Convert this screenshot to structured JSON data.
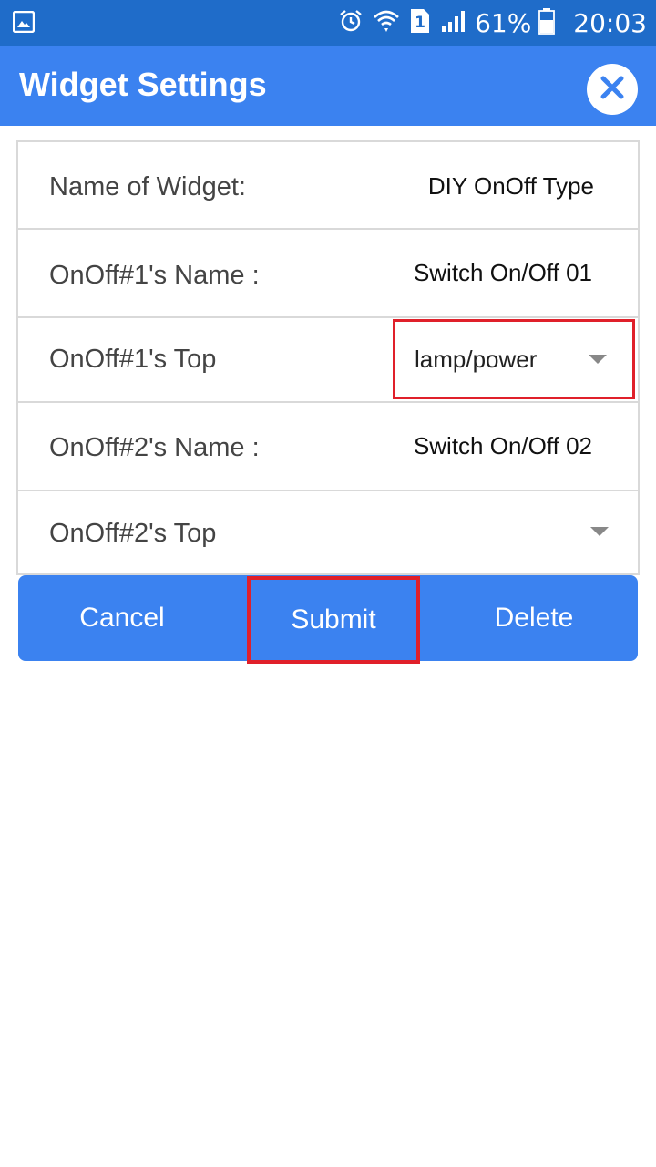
{
  "status_bar": {
    "battery": "61%",
    "time": "20:03",
    "sim_slot": "1",
    "icons": [
      "gallery-icon",
      "alarm-icon",
      "wifi-icon",
      "sim-icon",
      "signal-icon",
      "battery-icon"
    ]
  },
  "app_bar": {
    "title": "Widget Settings",
    "close_icon": "close-icon"
  },
  "form": {
    "rows": [
      {
        "label": "Name of Widget:",
        "value": "DIY OnOff Type"
      },
      {
        "label": "OnOff#1's Name :",
        "value": "Switch On/Off 01"
      },
      {
        "label": "OnOff#1's Top",
        "value": "lamp/power"
      },
      {
        "label": "OnOff#2's Name :",
        "value": "Switch On/Off 02"
      },
      {
        "label": "OnOff#2's Top",
        "value": ""
      }
    ]
  },
  "buttons": {
    "cancel": "Cancel",
    "submit": "Submit",
    "delete": "Delete"
  },
  "colors": {
    "status_bar": "#1f6cc9",
    "app_bar": "#3b82f0",
    "highlight": "#e0202a",
    "border": "#d9d9d9"
  }
}
